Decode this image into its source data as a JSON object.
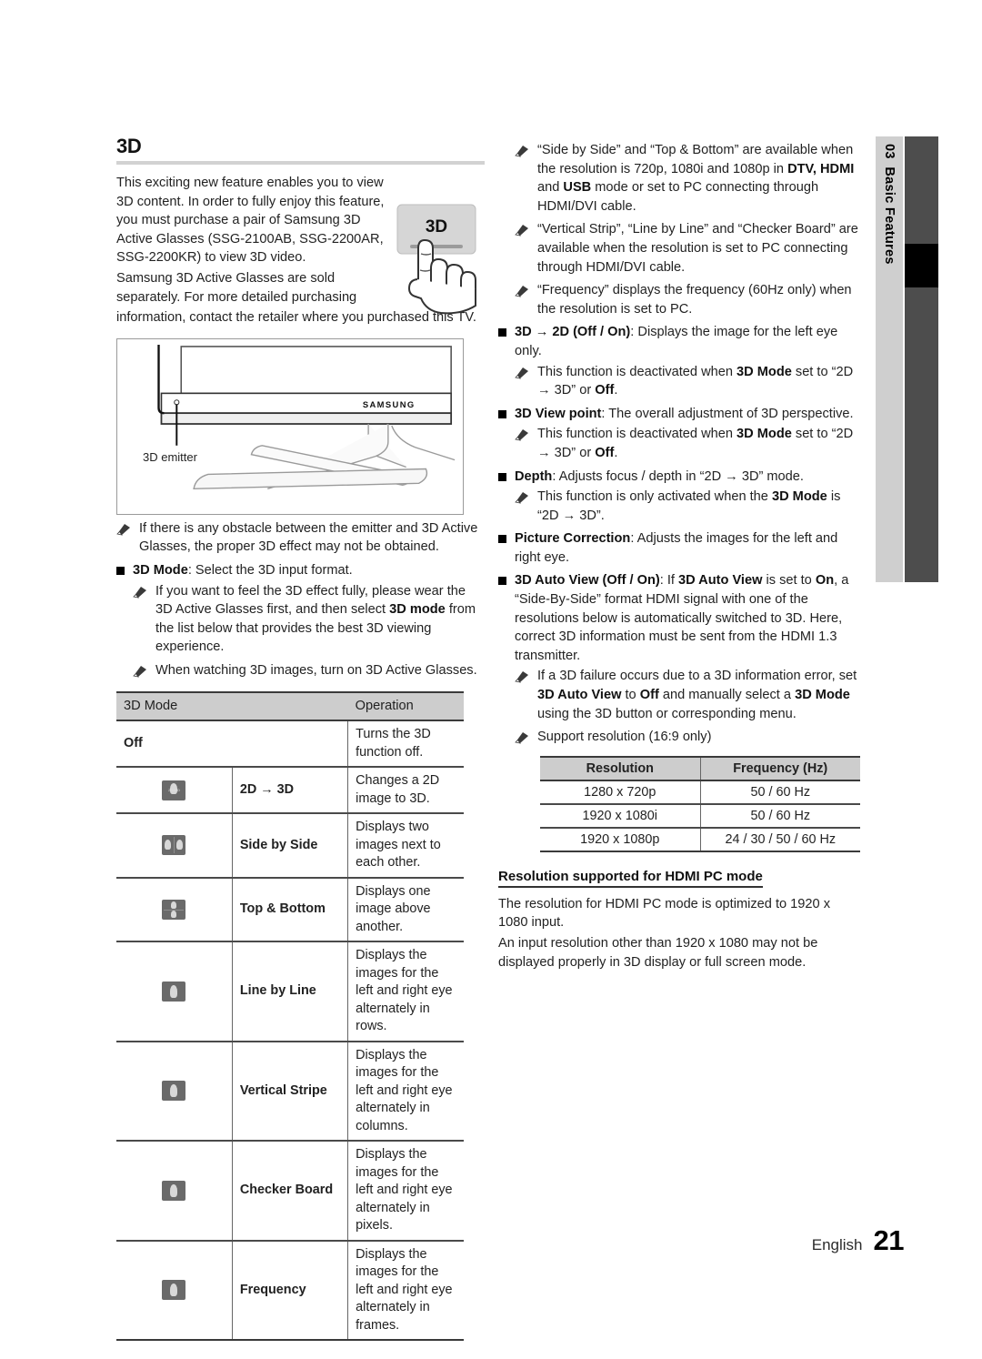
{
  "sidetab": {
    "number": "03",
    "label": "Basic Features"
  },
  "left": {
    "section_title": "3D",
    "intro_p1": "This exciting new feature enables you to view 3D content. In order to fully enjoy this feature, you must purchase a pair of Samsung 3D Active Glasses (SSG-2100AB, SSG-2200AR, SSG-2200KR) to view 3D video.",
    "intro_p2_a": "Samsung 3D Active Glasses are sold separately. For more detailed purchasing",
    "intro_p2_b": "information, contact the retailer where you purchased this TV.",
    "button_art_label": "3D",
    "tv_brand": "SAMSUNG",
    "emitter_label": "3D emitter",
    "note_obstacle": "If there is any obstacle between the emitter and 3D Active Glasses, the proper 3D effect may not be obtained.",
    "bullet_3dmode_title": "3D Mode",
    "bullet_3dmode_rest": ": Select the 3D input format.",
    "note_wear_a": "If you want to feel the 3D effect fully, please wear the 3D Active Glasses first, and then select ",
    "note_wear_b": "3D mode",
    "note_wear_c": " from the list below that provides the best 3D viewing experience.",
    "note_turnon": "When watching 3D images, turn on 3D Active Glasses."
  },
  "mode_table": {
    "headers": [
      "3D Mode",
      "Operation"
    ],
    "rows": [
      {
        "icon": "none",
        "name": "Off",
        "operation": "Turns the 3D function off."
      },
      {
        "icon": "2d-to-3d-icon",
        "name": "2D → 3D",
        "operation": "Changes a 2D image to 3D."
      },
      {
        "icon": "side-by-side-icon",
        "name": "Side by Side",
        "operation": "Displays two images next to each other."
      },
      {
        "icon": "top-bottom-icon",
        "name": "Top & Bottom",
        "operation": "Displays one image above another."
      },
      {
        "icon": "line-by-line-icon",
        "name": "Line by Line",
        "operation": "Displays the images for the left and right eye alternately in rows."
      },
      {
        "icon": "vertical-stripe-icon",
        "name": "Vertical Stripe",
        "operation": "Displays the images for the left and right eye alternately in columns."
      },
      {
        "icon": "checker-board-icon",
        "name": "Checker Board",
        "operation": "Displays the images for the left and right eye alternately in pixels."
      },
      {
        "icon": "frequency-icon",
        "name": "Frequency",
        "operation": "Displays the images for the left and right eye alternately in frames."
      }
    ]
  },
  "right": {
    "note_sbs_a": "“Side by Side” and “Top & Bottom” are available when the resolution is 720p, 1080i and 1080p in ",
    "note_sbs_b": "DTV, HDMI",
    "note_sbs_c": " and ",
    "note_sbs_d": "USB",
    "note_sbs_e": " mode or set to PC connecting through HDMI/DVI cable.",
    "note_vstrip": "“Vertical Strip”, “Line by Line” and “Checker Board” are available when the resolution is set to PC connecting through HDMI/DVI cable.",
    "note_freq": "“Frequency” displays the frequency (60Hz only) when the resolution is set to PC.",
    "b_3dto2d_title": "3D → 2D (Off / On)",
    "b_3dto2d_rest": ": Displays the image for the left eye only.",
    "note_deact_a": "This function is deactivated when ",
    "note_deact_b": "3D Mode",
    "note_deact_c": " set to “2D → 3D” or ",
    "note_deact_d": "Off",
    "note_deact_e": ".",
    "b_viewpoint_title": "3D View point",
    "b_viewpoint_rest": ": The overall adjustment of 3D perspective.",
    "b_depth_title": "Depth",
    "b_depth_rest": ": Adjusts focus / depth in “2D → 3D” mode.",
    "note_depth_a": "This function is only activated when the ",
    "note_depth_b": "3D Mode",
    "note_depth_c": " is “2D → 3D”.",
    "b_piccorr_title": "Picture Correction",
    "b_piccorr_rest": ": Adjusts the images for the left and right eye.",
    "b_autoview_title": "3D Auto View (Off / On)",
    "b_autoview_1": ": If ",
    "b_autoview_2": "3D Auto View",
    "b_autoview_3": " is set to ",
    "b_autoview_4": "On",
    "b_autoview_5": ", a “Side-By-Side” format HDMI signal with one of the resolutions below is automatically switched to 3D. Here, correct 3D information must be sent from the HDMI 1.3 transmitter.",
    "note_fail_1": "If a 3D failure occurs due to a 3D information error, set ",
    "note_fail_2": "3D Auto View",
    "note_fail_3": " to ",
    "note_fail_4": "Off",
    "note_fail_5": " and manually select a ",
    "note_fail_6": "3D Mode",
    "note_fail_7": " using the 3D button or corresponding menu.",
    "note_support": "Support resolution (16:9 only)",
    "sub_head": "Resolution supported for HDMI PC mode",
    "sub_p1": "The resolution for HDMI PC mode is optimized to 1920 x 1080 input.",
    "sub_p2": "An input resolution other than 1920 x 1080 may not be displayed properly in 3D display or full screen mode."
  },
  "res_table": {
    "headers": [
      "Resolution",
      "Frequency (Hz)"
    ],
    "rows": [
      [
        "1280 x 720p",
        "50 / 60 Hz"
      ],
      [
        "1920 x 1080i",
        "50 / 60 Hz"
      ],
      [
        "1920 x 1080p",
        "24 / 30 / 50 / 60 Hz"
      ]
    ]
  },
  "footer": {
    "language": "English",
    "page_number": "21"
  }
}
